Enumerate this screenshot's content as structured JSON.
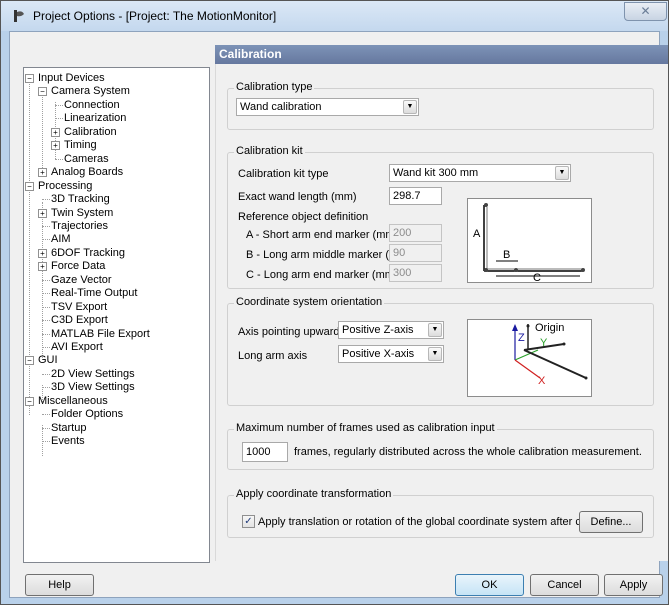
{
  "window": {
    "title": "Project Options - [Project: The MotionMonitor]",
    "close_glyph": "✕"
  },
  "tree": {
    "nodes": [
      {
        "label": "Input Devices",
        "expander": "−"
      },
      {
        "label": "Camera System",
        "expander": "−"
      },
      {
        "label": "Connection"
      },
      {
        "label": "Linearization"
      },
      {
        "label": "Calibration",
        "expander": "+"
      },
      {
        "label": "Timing",
        "expander": "+"
      },
      {
        "label": "Cameras"
      },
      {
        "label": "Analog Boards",
        "expander": "+"
      },
      {
        "label": "Processing",
        "expander": "−"
      },
      {
        "label": "3D Tracking"
      },
      {
        "label": "Twin System",
        "expander": "+"
      },
      {
        "label": "Trajectories"
      },
      {
        "label": "AIM"
      },
      {
        "label": "6DOF Tracking",
        "expander": "+"
      },
      {
        "label": "Force Data",
        "expander": "+"
      },
      {
        "label": "Gaze Vector"
      },
      {
        "label": "Real-Time Output"
      },
      {
        "label": "TSV Export"
      },
      {
        "label": "C3D Export"
      },
      {
        "label": "MATLAB File Export"
      },
      {
        "label": "AVI Export"
      },
      {
        "label": "GUI",
        "expander": "−"
      },
      {
        "label": "2D View Settings"
      },
      {
        "label": "3D View Settings"
      },
      {
        "label": "Miscellaneous",
        "expander": "−"
      },
      {
        "label": "Folder Options"
      },
      {
        "label": "Startup"
      },
      {
        "label": "Events"
      }
    ]
  },
  "panel": {
    "header": "Calibration",
    "calibration_type": {
      "title": "Calibration type",
      "selected": "Wand calibration"
    },
    "calibration_kit": {
      "title": "Calibration kit",
      "kit_type_label": "Calibration kit type",
      "kit_type_value": "Wand kit 300 mm",
      "wand_length_label": "Exact wand length (mm)",
      "wand_length_value": "298.7",
      "ref_def_label": "Reference object definition",
      "a_label": "A - Short arm end marker (mm)",
      "a_value": "200",
      "b_label": "B - Long arm middle marker (mm)",
      "b_value": "90",
      "c_label": "C - Long arm end marker (mm)",
      "c_value": "300",
      "diagram_labels": {
        "a": "A",
        "b": "B",
        "c": "C"
      }
    },
    "orientation": {
      "title": "Coordinate system orientation",
      "axis_up_label": "Axis pointing upwards",
      "axis_up_value": "Positive Z-axis",
      "long_arm_label": "Long arm axis",
      "long_arm_value": "Positive X-axis",
      "diagram_labels": {
        "origin": "Origin",
        "z": "Z",
        "y": "Y",
        "x": "X"
      }
    },
    "frames": {
      "title": "Maximum number of frames used as calibration input",
      "value": "1000",
      "suffix": "frames, regularly distributed across the whole calibration measurement."
    },
    "transform": {
      "title": "Apply coordinate transformation",
      "checkbox_label": "Apply translation or rotation of the global coordinate system after calibration",
      "checked_glyph": "✓",
      "define_button": "Define..."
    }
  },
  "buttons": {
    "help": "Help",
    "ok": "OK",
    "cancel": "Cancel",
    "apply": "Apply"
  },
  "icons": {
    "combo_arrow": "▼",
    "app_icon": "app-icon"
  }
}
